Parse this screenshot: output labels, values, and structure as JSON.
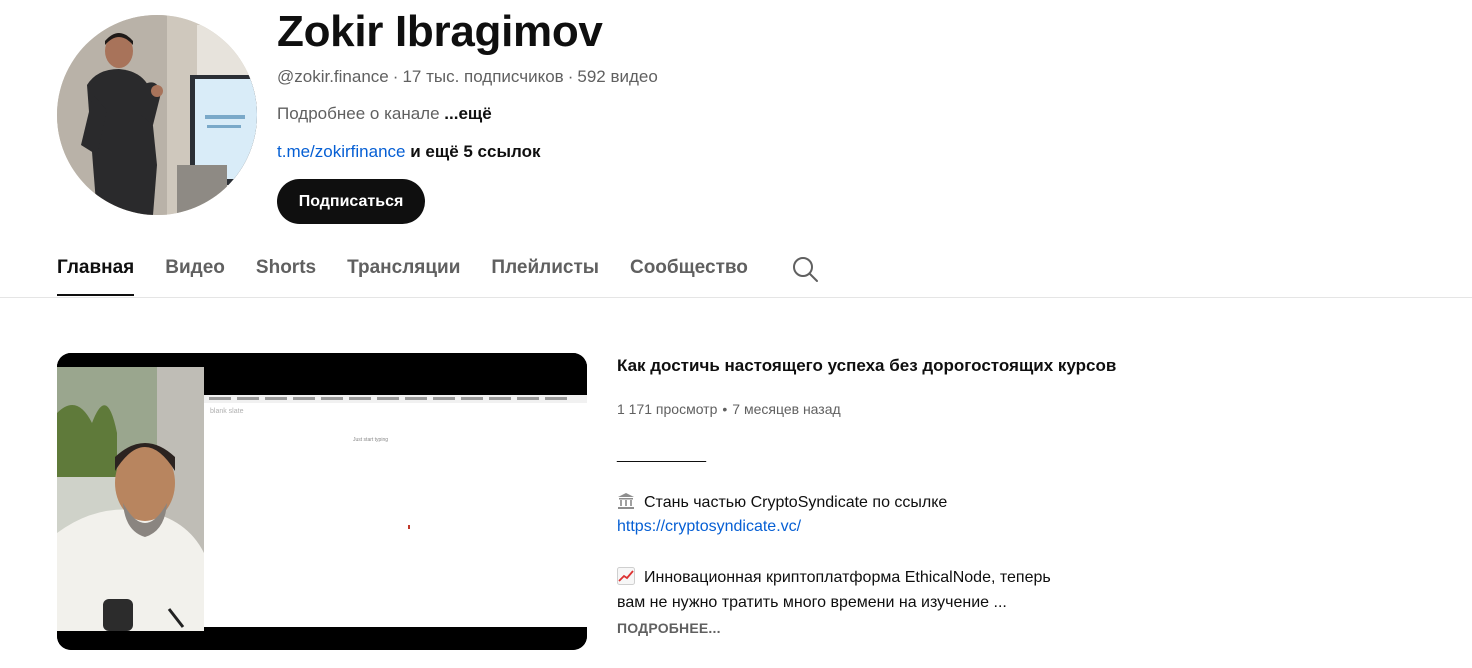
{
  "channel": {
    "name": "Zokir Ibragimov",
    "handle": "@zokir.finance",
    "subscribers": "17 тыс. подписчиков",
    "videos": "592 видео",
    "about_text": "Подробнее о канале",
    "about_more": "...ещё",
    "link_text": "t.me/zokirfinance",
    "link_extra": "и ещё 5 ссылок",
    "subscribe_label": "Подписаться"
  },
  "tabs": [
    {
      "label": "Главная",
      "active": true
    },
    {
      "label": "Видео"
    },
    {
      "label": "Shorts"
    },
    {
      "label": "Трансляции"
    },
    {
      "label": "Плейлисты"
    },
    {
      "label": "Сообщество"
    }
  ],
  "featured": {
    "title": "Как достичь настоящего успеха без дорогостоящих курсов",
    "views": "1 171 просмотр",
    "age": "7 месяцев назад",
    "desc_line1": "__________",
    "desc_line2": "Стань частью CryptoSyndicate по ссылке",
    "desc_link": "https://cryptosyndicate.vc/",
    "desc_line3": "Инновационная криптоплатформа EthicalNode, теперь",
    "desc_line4": "вам не нужно тратить много времени на изучение ...",
    "more_label": "ПОДРОБНЕЕ...",
    "thumb_text1": "blank slate",
    "thumb_text2": "Just start typing"
  },
  "colors": {
    "link": "#065fd4",
    "secondary_text": "#606060",
    "button_bg": "#0f0f0f"
  }
}
